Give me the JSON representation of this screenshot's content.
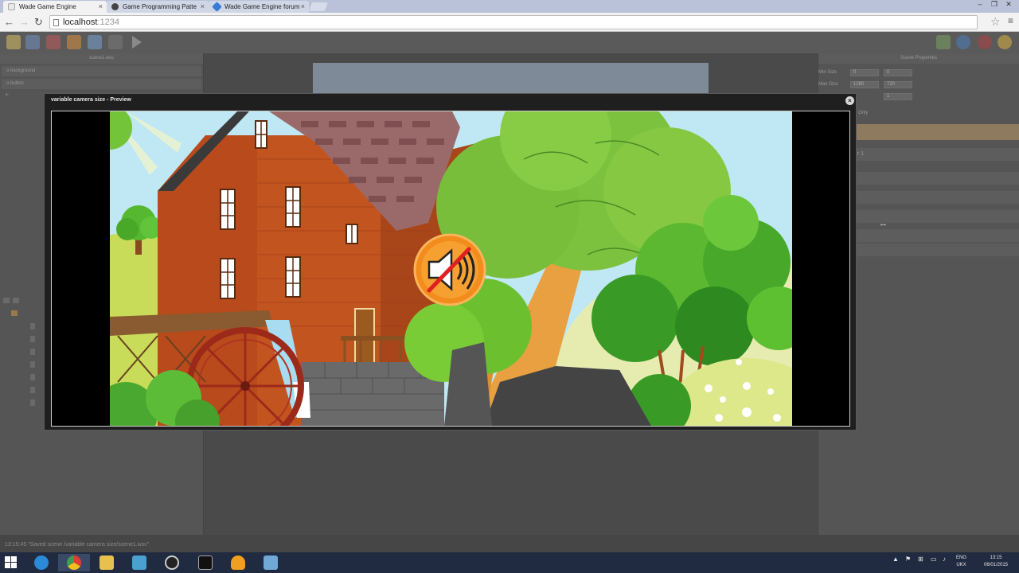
{
  "browser": {
    "tabs": [
      {
        "label": "Wade Game Engine",
        "active": true,
        "favicon_color": "#e8e8e8"
      },
      {
        "label": "Game Programming Patte",
        "active": false,
        "favicon_color": "#444444"
      },
      {
        "label": "Wade Game Engine forum",
        "active": false,
        "favicon_color": "#3a7bd5"
      }
    ],
    "close_glyph": "×",
    "url_host": "localhost",
    "url_port": ":1234",
    "window_buttons": [
      "–",
      "❐",
      "✕"
    ]
  },
  "editor": {
    "left_panel_title": "scene1.wsc",
    "layers": [
      "o background",
      "o button"
    ],
    "add_glyph": "+",
    "right_panel_title": "Scene Properties",
    "min_size_label": "Min Size",
    "max_size_label": "Max Size",
    "min_size_values": [
      "0",
      "0"
    ],
    "max_size_values": [
      "1280",
      "720"
    ],
    "zoom_value": "1",
    "only_button": "Only",
    "layer_label": "r 1",
    "status_text": "13:15:45 \"Saved scene /variable camera size/scene1.wsc\""
  },
  "preview": {
    "title": "variable camera size - Preview",
    "close_glyph": "×"
  },
  "taskbar": {
    "lang_top": "ENG",
    "lang_bottom": "UKX",
    "time": "13:15",
    "date": "06/01/2015",
    "tray_arrow": "▲"
  },
  "colors": {
    "taskbar": "#202a40",
    "editor_bg": "#4d4d4d",
    "mute_button": "#f28c1c",
    "barn": "#b5481e"
  }
}
